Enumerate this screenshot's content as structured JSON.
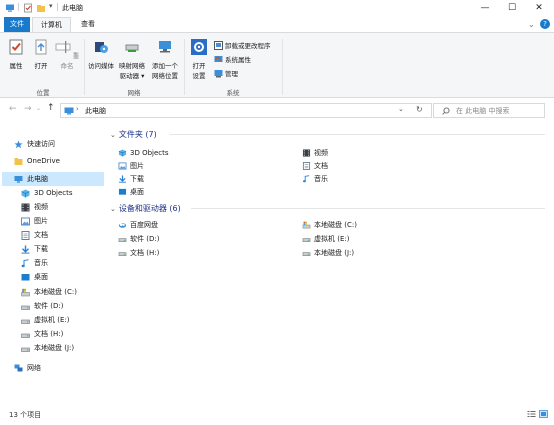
{
  "window": {
    "title": "此电脑",
    "minimize": "—",
    "maximize": "☐",
    "close": "✕"
  },
  "tabs": [
    "文件",
    "计算机",
    "查看"
  ],
  "help_icon": "?",
  "ribbon": {
    "location": {
      "label": "位置",
      "items": [
        "属性",
        "打开",
        "重命名"
      ]
    },
    "network": {
      "label": "网络",
      "items": [
        {
          "l1": "访问媒体",
          "l2": ""
        },
        {
          "l1": "映射网络",
          "l2": "驱动器 ▾"
        },
        {
          "l1": "添加一个",
          "l2": "网络位置"
        }
      ]
    },
    "system": {
      "label": "系统",
      "open": {
        "l1": "打开",
        "l2": "设置"
      },
      "small": [
        "卸载或更改程序",
        "系统属性",
        "管理"
      ]
    }
  },
  "address": {
    "path": "此电脑",
    "search_placeholder": "在 此电脑 中搜索",
    "back": "←",
    "forward": "→",
    "up": "↑"
  },
  "nav": [
    {
      "label": "快速访问",
      "icon": "star-icon"
    },
    {
      "label": "OneDrive",
      "icon": "folder-icon"
    },
    {
      "label": "此电脑",
      "icon": "pc-icon"
    },
    {
      "label": "3D Objects",
      "icon": "3d-objects-icon"
    },
    {
      "label": "视频",
      "icon": "video-icon"
    },
    {
      "label": "图片",
      "icon": "picture-icon"
    },
    {
      "label": "文档",
      "icon": "document-icon"
    },
    {
      "label": "下载",
      "icon": "download-icon"
    },
    {
      "label": "音乐",
      "icon": "music-icon"
    },
    {
      "label": "桌面",
      "icon": "desktop-icon"
    },
    {
      "label": "本地磁盘 (C:)",
      "icon": "os-drive-icon"
    },
    {
      "label": "软件 (D:)",
      "icon": "drive-icon"
    },
    {
      "label": "虚拟机 (E:)",
      "icon": "drive-icon"
    },
    {
      "label": "文档 (H:)",
      "icon": "drive-icon"
    },
    {
      "label": "本地磁盘 (J:)",
      "icon": "drive-icon"
    },
    {
      "label": "网络",
      "icon": "network-icon"
    }
  ],
  "folders": {
    "header": "文件夹 (7)",
    "items": [
      "3D Objects",
      "视频",
      "图片",
      "文档",
      "下载",
      "音乐",
      "桌面"
    ]
  },
  "drives": {
    "header": "设备和驱动器 (6)",
    "items": [
      "百度网盘",
      "本地磁盘 (C:)",
      "软件 (D:)",
      "虚拟机 (E:)",
      "文档 (H:)",
      "本地磁盘 (J:)"
    ]
  },
  "status": "13 个项目",
  "colors": {
    "accent": "#1979ca",
    "selection": "#cce8ff",
    "header_text": "#1e3287",
    "folder_yellow": "#f4c24b"
  }
}
